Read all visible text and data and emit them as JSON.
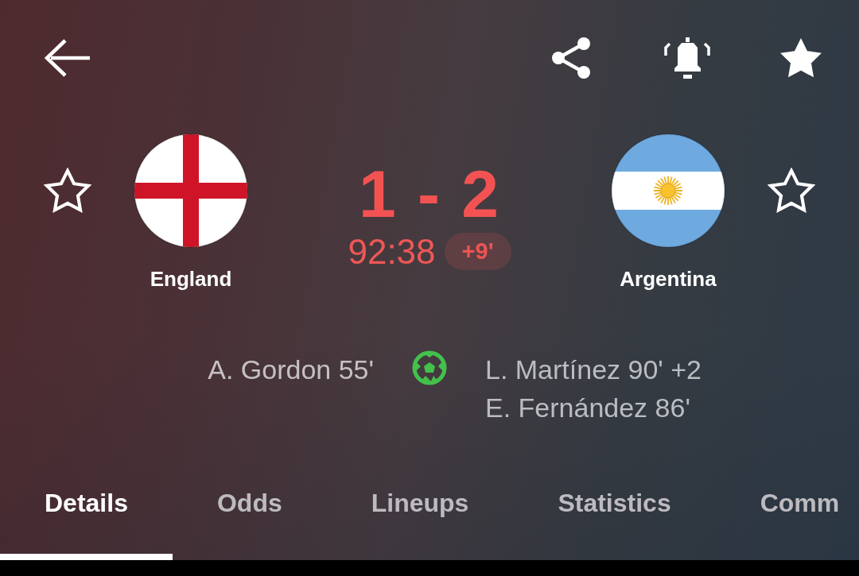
{
  "toolbar": {
    "notifications": true,
    "favorite": true
  },
  "teams": [
    {
      "name": "England",
      "favorite": false
    },
    {
      "name": "Argentina",
      "favorite": false
    }
  ],
  "score": "1 - 2",
  "clock": "92:38",
  "added_time": "+9'",
  "goals": {
    "home": [
      "A. Gordon 55'"
    ],
    "away": [
      "L. Martínez 90' +2",
      "E. Fernández 86'"
    ]
  },
  "tabs": [
    {
      "label": "Details",
      "selected": true
    },
    {
      "label": "Odds",
      "selected": false
    },
    {
      "label": "Lineups",
      "selected": false
    },
    {
      "label": "Statistics",
      "selected": false
    },
    {
      "label": "Comm",
      "selected": false
    }
  ]
}
